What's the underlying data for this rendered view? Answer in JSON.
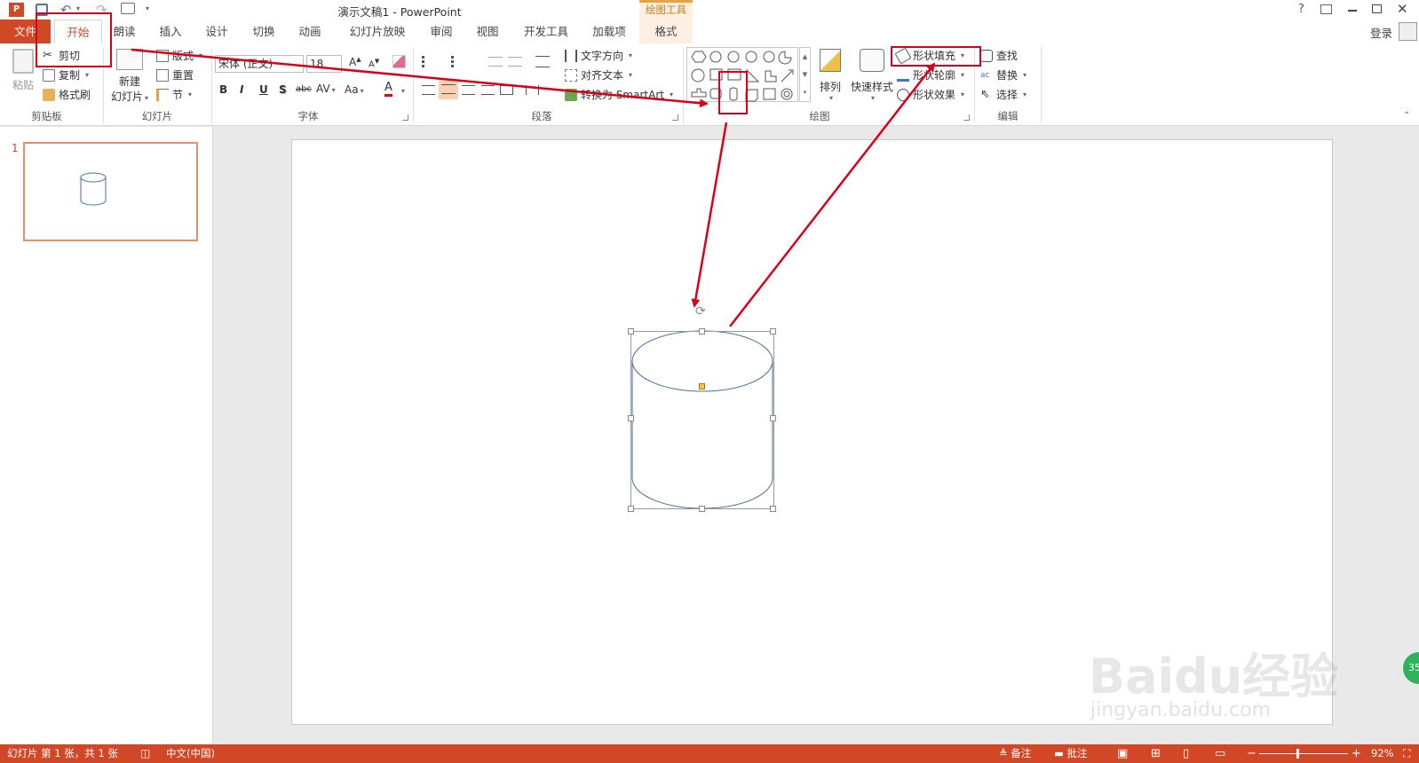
{
  "window": {
    "title": "演示文稿1 - PowerPoint",
    "help": "?",
    "login": "登录"
  },
  "tabs": [
    "文件",
    "开始",
    "朗读",
    "插入",
    "设计",
    "切换",
    "动画",
    "幻灯片放映",
    "审阅",
    "视图",
    "开发工具",
    "加载项",
    "格式"
  ],
  "drawing_tools_label": "绘图工具",
  "ribbon": {
    "clipboard": {
      "paste": "粘贴",
      "cut": "剪切",
      "copy": "复制",
      "format_painter": "格式刷",
      "label": "剪贴板"
    },
    "slides": {
      "new_slide_1": "新建",
      "new_slide_2": "幻灯片",
      "layout": "版式",
      "reset": "重置",
      "section": "节",
      "label": "幻灯片"
    },
    "font": {
      "name": "宋体 (正文)",
      "size": "18",
      "bold": "B",
      "italic": "I",
      "underline": "U",
      "shadow": "S",
      "strike": "abc",
      "spacing": "AV",
      "case": "Aa",
      "color": "A",
      "label": "字体"
    },
    "paragraph": {
      "text_direction": "文字方向",
      "align_text": "对齐文本",
      "smartart": "转换为 SmartArt",
      "label": "段落"
    },
    "drawing": {
      "arrange": "排列",
      "quick_styles": "快速样式",
      "shape_fill": "形状填充",
      "shape_outline": "形状轮廓",
      "shape_effects": "形状效果",
      "label": "绘图"
    },
    "editing": {
      "find": "查找",
      "replace": "替换",
      "select": "选择",
      "label": "编辑"
    }
  },
  "panel": {
    "slide_number": "1"
  },
  "status": {
    "slide_info": "幻灯片 第 1 张，共 1 张",
    "language": "中文(中国)",
    "notes": "备注",
    "comments": "批注",
    "zoom": "92%"
  },
  "watermark": {
    "brand": "Baidu经验",
    "url": "jingyan.baidu.com"
  },
  "badge": "35",
  "colors": {
    "accent": "#d24726",
    "annotation_red": "#d9001b",
    "shape_outline": "#41719c"
  }
}
